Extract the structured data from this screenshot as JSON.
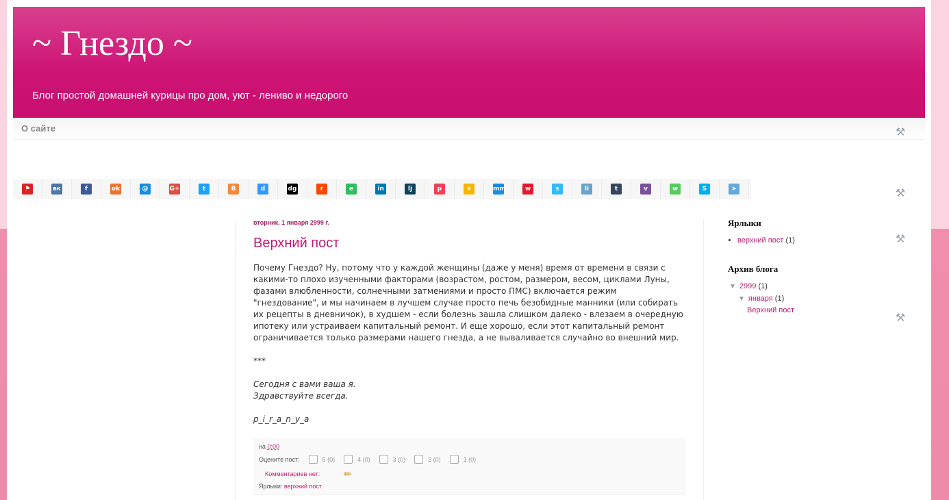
{
  "header": {
    "title": "~ Гнездо ~",
    "description": "Блог простой домашней курицы про дом, уют - лениво и недорого"
  },
  "nav": {
    "items": [
      "О сайте"
    ]
  },
  "share": {
    "buttons": [
      {
        "name": "bookmark",
        "color": "#dd2222",
        "glyph": "⚑"
      },
      {
        "name": "vk",
        "color": "#4c75a3",
        "glyph": "вк"
      },
      {
        "name": "facebook",
        "color": "#3b5998",
        "glyph": "f"
      },
      {
        "name": "odnoklassniki",
        "color": "#eb722e",
        "glyph": "ok"
      },
      {
        "name": "mail",
        "color": "#168de2",
        "glyph": "@"
      },
      {
        "name": "google-plus",
        "color": "#dc4e41",
        "glyph": "G+"
      },
      {
        "name": "twitter",
        "color": "#1da1f2",
        "glyph": "t"
      },
      {
        "name": "blogger",
        "color": "#f38936",
        "glyph": "B"
      },
      {
        "name": "delicious",
        "color": "#3399ff",
        "glyph": "d"
      },
      {
        "name": "digg",
        "color": "#000000",
        "glyph": "dg"
      },
      {
        "name": "reddit",
        "color": "#ff4500",
        "glyph": "r"
      },
      {
        "name": "evernote",
        "color": "#2dbe60",
        "glyph": "e"
      },
      {
        "name": "linkedin",
        "color": "#0077b5",
        "glyph": "in"
      },
      {
        "name": "livejournal",
        "color": "#0d425a",
        "glyph": "lj"
      },
      {
        "name": "pocket",
        "color": "#ef4056",
        "glyph": "p"
      },
      {
        "name": "favorites",
        "color": "#f6b500",
        "glyph": "★"
      },
      {
        "name": "moimir",
        "color": "#168de2",
        "glyph": "mm"
      },
      {
        "name": "weibo",
        "color": "#e6162d",
        "glyph": "w"
      },
      {
        "name": "surfingbird",
        "color": "#30bafa",
        "glyph": "s"
      },
      {
        "name": "liveinternet",
        "color": "#6aa3c9",
        "glyph": "li"
      },
      {
        "name": "tumblr",
        "color": "#35465c",
        "glyph": "t"
      },
      {
        "name": "viber",
        "color": "#7b519d",
        "glyph": "v"
      },
      {
        "name": "whatsapp",
        "color": "#4fce5d",
        "glyph": "w"
      },
      {
        "name": "skype",
        "color": "#00aff0",
        "glyph": "S"
      },
      {
        "name": "telegram",
        "color": "#64a9dc",
        "glyph": "➤"
      }
    ]
  },
  "post": {
    "date": "вторник, 1 января 2999 г.",
    "title": "Верхний пост",
    "body": "Почему Гнездо? Ну, потому что у каждой женщины (даже у меня) время от времени в связи с какими-то плохо изученными факторами (возрастом, ростом, размером, весом, циклами Луны, фазами влюбленности, солнечными затмениями и просто ПМС) включается режим \"гнездование\", и мы начинаем в лучшем случае просто печь безобидные манники (или собирать их рецепты в дневничок), в худшем - если болезнь зашла слишком далеко - влезаем в очередную ипотеку или устраиваем капитальный ремонт. И еще хорошо, если этот капитальный ремонт ограничивается только размерами нашего гнезда, а не вываливается случайно во внешний мир.",
    "separator": "***",
    "sign1": "Сегодня с вами ваша я.",
    "sign2": "Здравствуйте всегда.",
    "signature": "p_i_r_a_n_y_a",
    "footer": {
      "at": "на",
      "time": "0:00",
      "rate_label": "Оцените пост:",
      "ratings": [
        "5 (0)",
        "4 (0)",
        "3 (0)",
        "2 (0)",
        "1 (0)"
      ],
      "comments": "Комментариев нет:",
      "labels_prefix": "Ярлыки:",
      "label": "верхний пост"
    }
  },
  "sidebar": {
    "labels_title": "Ярлыки",
    "labels": [
      {
        "name": "верхний пост",
        "count": "(1)"
      }
    ],
    "archive_title": "Архив блога",
    "archive_year": "2999",
    "archive_year_count": "(1)",
    "archive_month": "января",
    "archive_month_count": "(1)",
    "archive_post": "Верхний пост"
  }
}
